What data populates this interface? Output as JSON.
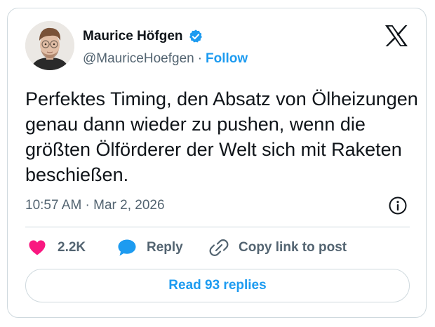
{
  "author": {
    "name": "Maurice Höfgen",
    "handle": "@MauriceHoefgen",
    "separator": "·",
    "follow_label": "Follow",
    "avatar_icon": "profile-photo",
    "verified_icon": "verified-badge-icon"
  },
  "platform": {
    "logo_icon": "x-logo-icon"
  },
  "tweet": {
    "text": "Perfektes Timing, den Absatz von Ölheizungen genau dann wieder zu pushen, wenn die größten Ölförderer der Welt sich mit Raketen beschießen.",
    "timestamp": "10:57 AM · Mar 2, 2026",
    "info_icon": "info-icon"
  },
  "actions": {
    "likes_count": "2.2K",
    "reply_label": "Reply",
    "copy_link_label": "Copy link to post"
  },
  "footer": {
    "read_replies_label": "Read 93 replies"
  },
  "colors": {
    "accent": "#1d9bf0",
    "like_heart": "#f91880",
    "reply_bubble": "#1d9bf0",
    "text_primary": "#0f1419",
    "text_secondary": "#536471",
    "border": "#cfd9de"
  }
}
